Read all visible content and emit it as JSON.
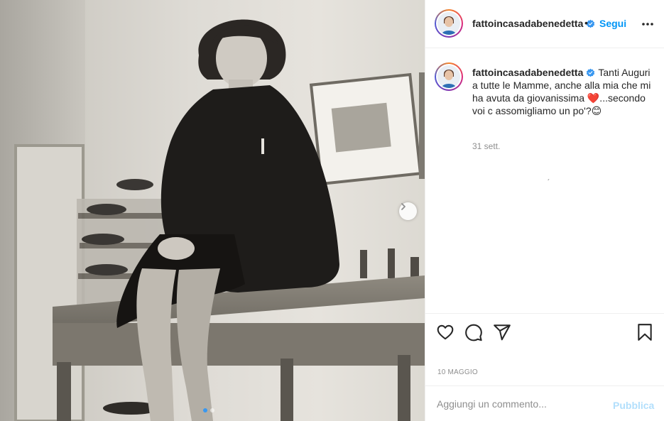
{
  "post": {
    "account": "fattoincasadabenedetta",
    "separator": "•",
    "follow_label": "Segui",
    "caption_text": "Tanti Auguri a tutte le Mamme, anche alla mia che mi ha avuta da giovanissima ❤️...secondo voi c assomigliamo un po'?😊",
    "caption_time": "31 sett.",
    "stray_mark": "´",
    "date": "10 MAGGIO",
    "carousel": {
      "slides": 2,
      "active": 1
    }
  },
  "comment": {
    "placeholder": "Aggiungi un commento...",
    "publish_label": "Pubblica"
  },
  "icons": {
    "verified": "verified-badge-icon",
    "more": "more-options-icon",
    "like": "heart-icon",
    "comment": "comment-bubble-icon",
    "share": "paper-plane-icon",
    "save": "bookmark-icon",
    "next": "chevron-right-icon"
  },
  "colors": {
    "accent": "#0095f6",
    "publish_disabled": "#b2dffc",
    "verified": "#3897f0",
    "muted": "#8e8e8e",
    "text": "#262626"
  }
}
